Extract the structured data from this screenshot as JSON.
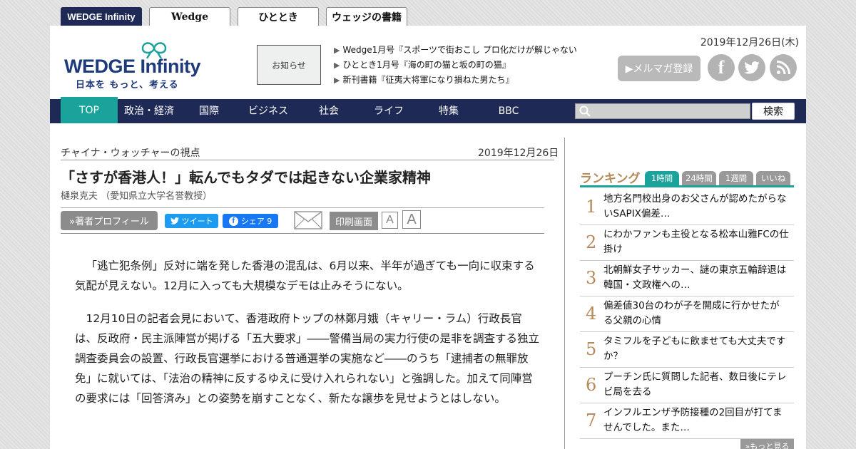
{
  "site_tabs": [
    "WEDGE Infinity",
    "Wedge",
    "ひととき",
    "ウェッジの書籍"
  ],
  "header": {
    "logo_text": "WEDGE Infinity",
    "logo_tagline": "日本を もっと、考える",
    "notice_label": "お知らせ",
    "news": [
      "Wedge1月号『スポーツで街おこし プロ化だけが解じゃない",
      "ひととき1月号『海の町の猫と坂の町の猫』",
      "新刊書籍『征夷大将軍になり損ねた男たち』"
    ],
    "date": "2019年12月26日(木)",
    "mailmag_label": "▶メルマガ登録",
    "social": [
      "facebook-icon",
      "twitter-icon",
      "rss-icon"
    ]
  },
  "nav": {
    "items": [
      "TOP",
      "政治・経済",
      "国際",
      "ビジネス",
      "社会",
      "ライフ",
      "特集",
      "BBC"
    ],
    "active": "TOP",
    "search_button": "検索"
  },
  "article": {
    "series": "チャイナ・ウォッチャーの視点",
    "date": "2019年12月26日",
    "headline": "「さすが香港人！」転んでもタダでは起きない企業家精神",
    "author": "樋泉克夫 （愛知県立大学名誉教授）",
    "profile_button": "»著者プロフィール",
    "tweet_label": "ツイート",
    "share_label": "シェア 9",
    "print_label": "印刷画面",
    "font_small": "A",
    "font_large": "A",
    "paragraphs": [
      "「逃亡犯条例」反対に端を発した香港の混乱は、6月以来、半年が過ぎても一向に収束する気配が見えない。12月に入っても大規模なデモは止みそうにない。",
      "12月10日の記者会見において、香港政府トップの林鄭月娥（キャリー・ラム）行政長官は、反政府・民主派陣営が掲げる「五大要求」――警備当局の実力行使の是非を調査する独立調査委員会の設置、行政長官選挙における普通選挙の実施など――のうち「逮捕者の無罪放免」に就いては、「法治の精神に反するゆえに受け入れられない」と強調した。加えて同陣営の要求には「回答済み」との姿勢を崩すことなく、新たな譲歩を見せようとはしない。"
    ]
  },
  "ranking": {
    "title": "ランキング",
    "tabs": [
      "1時間",
      "24時間",
      "1週間",
      "いいね"
    ],
    "active_tab": "1時間",
    "items": [
      {
        "num": "1",
        "text": "地方名門校出身のお父さんが認めたがらないSAPIX偏差…"
      },
      {
        "num": "2",
        "text": "にわかファンも主役となる松本山雅FCの仕掛け"
      },
      {
        "num": "3",
        "text": "北朝鮮女子サッカー、謎の東京五輪辞退は韓国・文政権への…"
      },
      {
        "num": "4",
        "text": "偏差値30台のわが子を開成に行かせたがる父親の心情"
      },
      {
        "num": "5",
        "text": "タミフルを子どもに飲ませても大丈夫ですか？"
      },
      {
        "num": "6",
        "text": "プーチン氏に質問した記者、数日後にテレビ局を去る"
      },
      {
        "num": "7",
        "text": "インフルエンザ予防接種の2回目が打てませんでした。また…"
      }
    ],
    "more_label": "»もっと見る"
  },
  "colors": {
    "navy": "#1e2a55",
    "teal": "#1aa39a",
    "rank_gold": "#b58a5a"
  }
}
